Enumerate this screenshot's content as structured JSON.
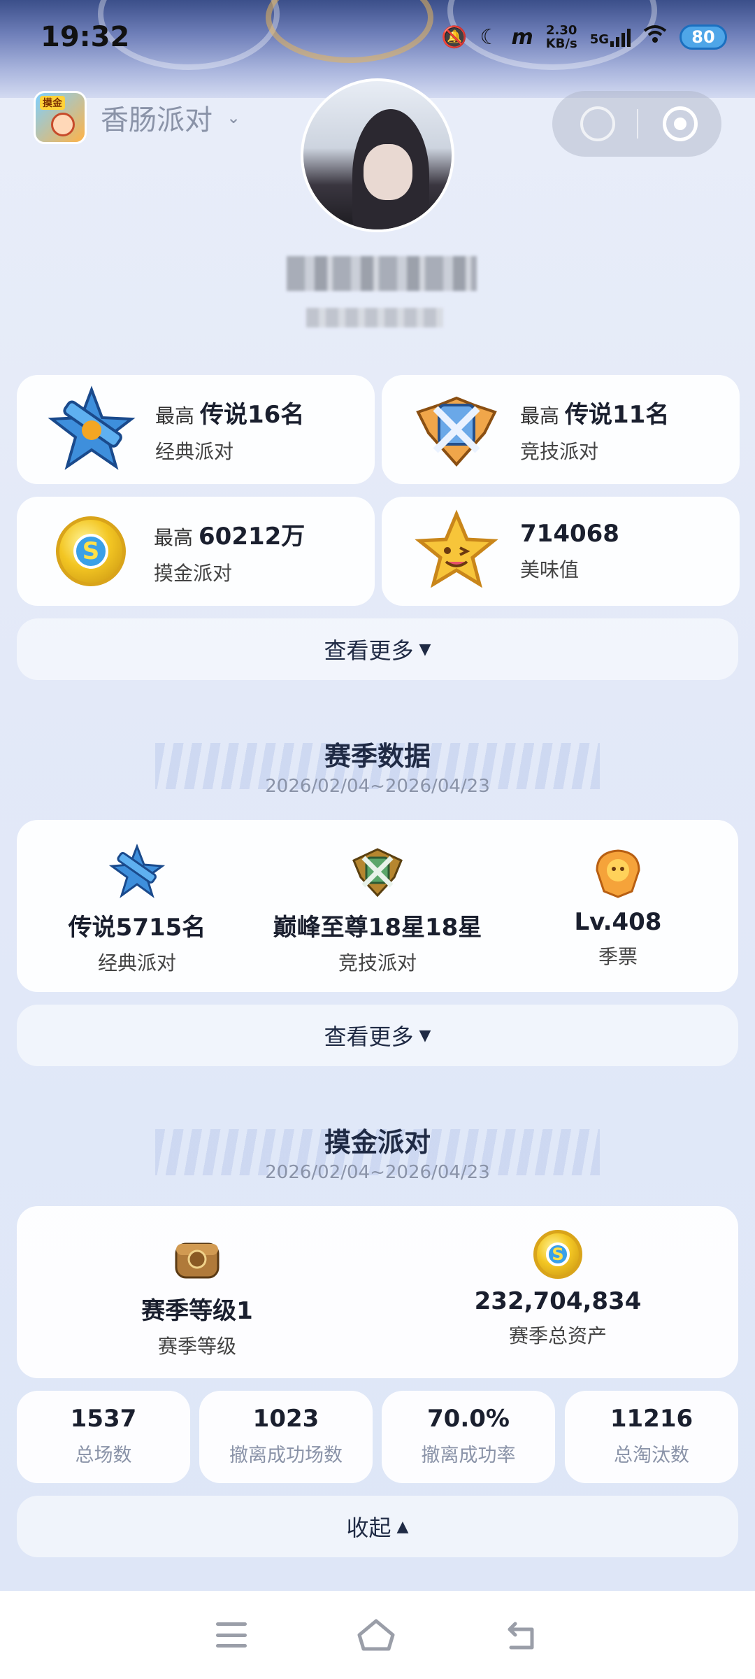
{
  "status_bar": {
    "time": "19:32",
    "net_speed_top": "2.30",
    "net_speed_bottom": "KB/s",
    "network": "5G",
    "battery": "80"
  },
  "header": {
    "game_name": "香肠派对"
  },
  "summary_cards": [
    {
      "prefix": "最高",
      "value": "传说16名",
      "label": "经典派对",
      "icon": "classic-rank-icon"
    },
    {
      "prefix": "最高",
      "value": "传说11名",
      "label": "竞技派对",
      "icon": "competitive-rank-icon"
    },
    {
      "prefix": "最高",
      "value": "60212万",
      "label": "摸金派对",
      "icon": "gold-coin-icon"
    },
    {
      "prefix": "",
      "value": "714068",
      "label": "美味值",
      "icon": "star-face-icon"
    }
  ],
  "see_more": "查看更多",
  "season": {
    "title": "赛季数据",
    "date_range": "2026/02/04~2026/04/23",
    "items": [
      {
        "value": "传说5715名",
        "label": "经典派对"
      },
      {
        "value": "巅峰至尊18星18星",
        "label": "竞技派对"
      },
      {
        "value": "Lv.408",
        "label": "季票"
      }
    ]
  },
  "gold_party": {
    "title": "摸金派对",
    "date_range": "2026/02/04~2026/04/23",
    "items": [
      {
        "value": "赛季等级1",
        "label": "赛季等级"
      },
      {
        "value": "232,704,834",
        "label": "赛季总资产"
      }
    ],
    "stats": [
      {
        "value": "1537",
        "label": "总场数"
      },
      {
        "value": "1023",
        "label": "撤离成功场数"
      },
      {
        "value": "70.0%",
        "label": "撤离成功率"
      },
      {
        "value": "11216",
        "label": "总淘汰数"
      }
    ],
    "collapse": "收起"
  }
}
